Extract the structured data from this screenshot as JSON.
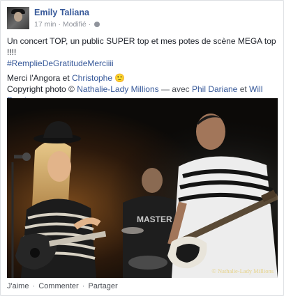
{
  "post": {
    "author": "Emily Taliana",
    "time": "17 min",
    "separator": "·",
    "edited": "Modifié",
    "privacy_icon": "globe-icon",
    "text_line1": "Un concert TOP, un public SUPER top et mes potes de scène MEGA top !!!!",
    "hashtag": "#RemplieDeGratitudeMerciiii",
    "merci_prefix": "Merci l'Angora et ",
    "mention_christophe": "Christophe",
    "smiley": "🙂",
    "copyright_prefix": "Copyright photo © ",
    "mention_photographer": "Nathalie-Lady Millions",
    "avec_text": " — avec ",
    "mention_phil": "Phil Dariane",
    "et_text": " et ",
    "mention_will": "Will Parniere",
    "period": ".",
    "photo_watermark": "© Nathalie-Lady Millions",
    "photo_shirt_text": "MASTER"
  },
  "actions": {
    "like": "J'aime",
    "comment": "Commenter",
    "share": "Partager",
    "separator": "·"
  },
  "colors": {
    "link": "#365899",
    "text": "#1d2129",
    "meta": "#90949c"
  }
}
